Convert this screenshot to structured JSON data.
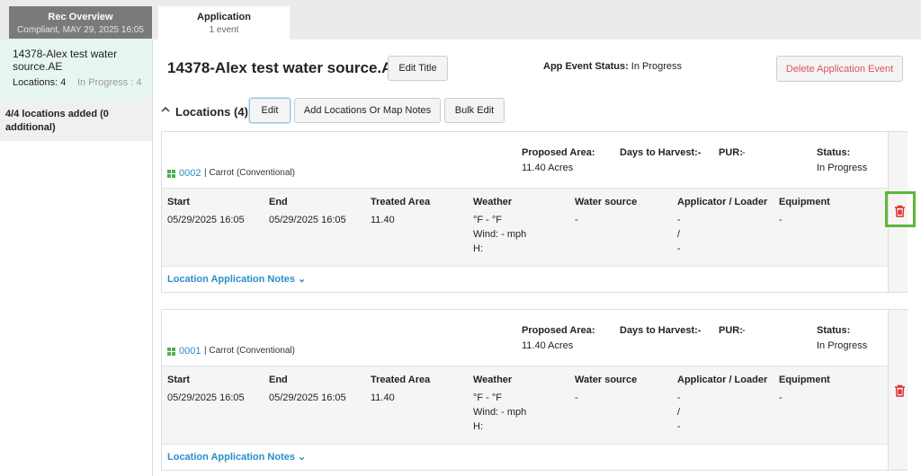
{
  "tabs": {
    "rec": {
      "title": "Rec Overview",
      "subtitle": "Compliant, MAY 29, 2025 16:05"
    },
    "app": {
      "title": "Application",
      "subtitle": "1 event"
    }
  },
  "sidebar": {
    "item_title": "14378-Alex test water source.AE",
    "locations": "Locations: 4",
    "progress": "In Progress : 4",
    "added": "4/4 locations added (0 additional)"
  },
  "header": {
    "title": "14378-Alex test water source.AE",
    "edit_title": "Edit Title",
    "status_label": "App Event Status:",
    "status_value": "In Progress",
    "delete_event": "Delete Application Event"
  },
  "locations_bar": {
    "title": "Locations (4)",
    "edit": "Edit",
    "add_notes": "Add Locations Or Map Notes",
    "bulk_edit": "Bulk Edit"
  },
  "cards": [
    {
      "code": "0002",
      "crop": "| Carrot (Conventional)",
      "proposed_area_label": "Proposed Area:",
      "proposed_area_value": "11.40   Acres",
      "days_label": "Days to Harvest:-",
      "pur_label": "PUR:",
      "pur_value": "-",
      "status_label": "Status:",
      "status_value": "In Progress",
      "cols": {
        "start": "Start",
        "end": "End",
        "treated": "Treated Area",
        "weather": "Weather",
        "water": "Water source",
        "applicator": "Applicator / Loader",
        "equipment": "Equipment"
      },
      "start": "05/29/2025  16:05",
      "end": "05/29/2025  16:05",
      "treated": "11.40",
      "weather_temp": "°F - °F",
      "weather_wind": "Wind: - mph",
      "weather_h": "H:",
      "water": "-",
      "applicator_1": "-",
      "applicator_2": "/",
      "applicator_3": "-",
      "equipment": "-",
      "notes": "Location Application Notes ⌄"
    },
    {
      "code": "0001",
      "crop": "| Carrot (Conventional)",
      "proposed_area_label": "Proposed Area:",
      "proposed_area_value": "11.40   Acres",
      "days_label": "Days to Harvest:-",
      "pur_label": "PUR:",
      "pur_value": "-",
      "status_label": "Status:",
      "status_value": "In Progress",
      "cols": {
        "start": "Start",
        "end": "End",
        "treated": "Treated Area",
        "weather": "Weather",
        "water": "Water source",
        "applicator": "Applicator / Loader",
        "equipment": "Equipment"
      },
      "start": "05/29/2025  16:05",
      "end": "05/29/2025  16:05",
      "treated": "11.40",
      "weather_temp": "°F - °F",
      "weather_wind": "Wind: - mph",
      "weather_h": "H:",
      "water": "-",
      "applicator_1": "-",
      "applicator_2": "/",
      "applicator_3": "-",
      "equipment": "-",
      "notes": "Location Application Notes ⌄"
    }
  ],
  "icons": {
    "trash": "trash-icon",
    "chevron": "chevron-up-icon",
    "field": "field-grid-icon"
  },
  "colors": {
    "accent": "#2a8fc7",
    "danger": "#e02c2c",
    "highlight": "#5db83a"
  }
}
